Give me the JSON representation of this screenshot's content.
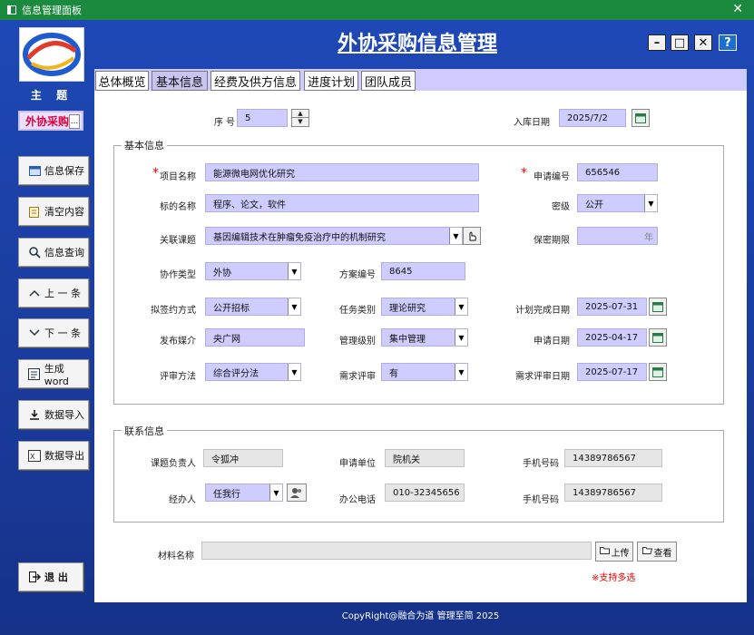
{
  "window": {
    "title": "信息管理面板",
    "close_glyph": "✕"
  },
  "app": {
    "main_title": "外协采购信息管理",
    "theme_label": "主 题",
    "theme_value": "外协采购",
    "theme_dots": "..."
  },
  "sidebar": [
    {
      "label": "信息保存",
      "icon": "save-icon"
    },
    {
      "label": "清空内容",
      "icon": "clear-icon"
    },
    {
      "label": "信息查询",
      "icon": "search-icon"
    },
    {
      "label": "上 一 条",
      "icon": "up-icon"
    },
    {
      "label": "下 一 条",
      "icon": "down-icon"
    },
    {
      "label": "生成word",
      "icon": "word-icon"
    },
    {
      "label": "数据导入",
      "icon": "import-icon"
    },
    {
      "label": "数据导出",
      "icon": "export-icon"
    }
  ],
  "exit_label": "退 出",
  "window_controls": {
    "min": "–",
    "max": "□",
    "close": "✕",
    "help": "?"
  },
  "tabs": [
    "总体概览",
    "基本信息",
    "经费及供方信息",
    "进度计划",
    "团队成员"
  ],
  "active_tab": 1,
  "top_fields": {
    "seq_label": "序 号",
    "seq_value": "5",
    "date_label": "入库日期",
    "date_value": "2025/7/2"
  },
  "basic": {
    "title": "基本信息",
    "project_name_label": "项目名称",
    "project_name": "能源微电网优化研究",
    "apply_no_label": "申请编号",
    "apply_no": "656546",
    "target_label": "标的名称",
    "target": "程序、论文，软件",
    "secret_label": "密级",
    "secret": "公开",
    "topic_label": "关联课题",
    "topic": "基因编辑技术在肿瘤免疫治疗中的机制研究",
    "secret_period_label": "保密期限",
    "secret_period_unit": "年",
    "coop_type_label": "协作类型",
    "coop_type": "外协",
    "plan_no_label": "方案编号",
    "plan_no": "8645",
    "sign_method_label": "拟签约方式",
    "sign_method": "公开招标",
    "task_type_label": "任务类别",
    "task_type": "理论研究",
    "plan_finish_label": "计划完成日期",
    "plan_finish": "2025-07-31",
    "media_label": "发布媒介",
    "media": "央广网",
    "manage_level_label": "管理级别",
    "manage_level": "集中管理",
    "apply_date_label": "申请日期",
    "apply_date": "2025-04-17",
    "review_method_label": "评审方法",
    "review_method": "综合评分法",
    "review_need_label": "需求评审",
    "review_need": "有",
    "review_date_label": "需求评审日期",
    "review_date": "2025-07-17"
  },
  "contact": {
    "title": "联系信息",
    "leader_label": "课题负责人",
    "leader": "令狐冲",
    "unit_label": "申请单位",
    "unit": "院机关",
    "phone1_label": "手机号码",
    "phone1": "14389786567",
    "handler_label": "经办人",
    "handler": "任我行",
    "office_label": "办公电话",
    "office": "010-32345656",
    "phone2_label": "手机号码",
    "phone2": "14389786567"
  },
  "material": {
    "label": "材料名称",
    "upload": "上传",
    "view": "查看",
    "note": "※支持多选"
  },
  "footer": "CopyRight@融合为道 管理至简 2025"
}
